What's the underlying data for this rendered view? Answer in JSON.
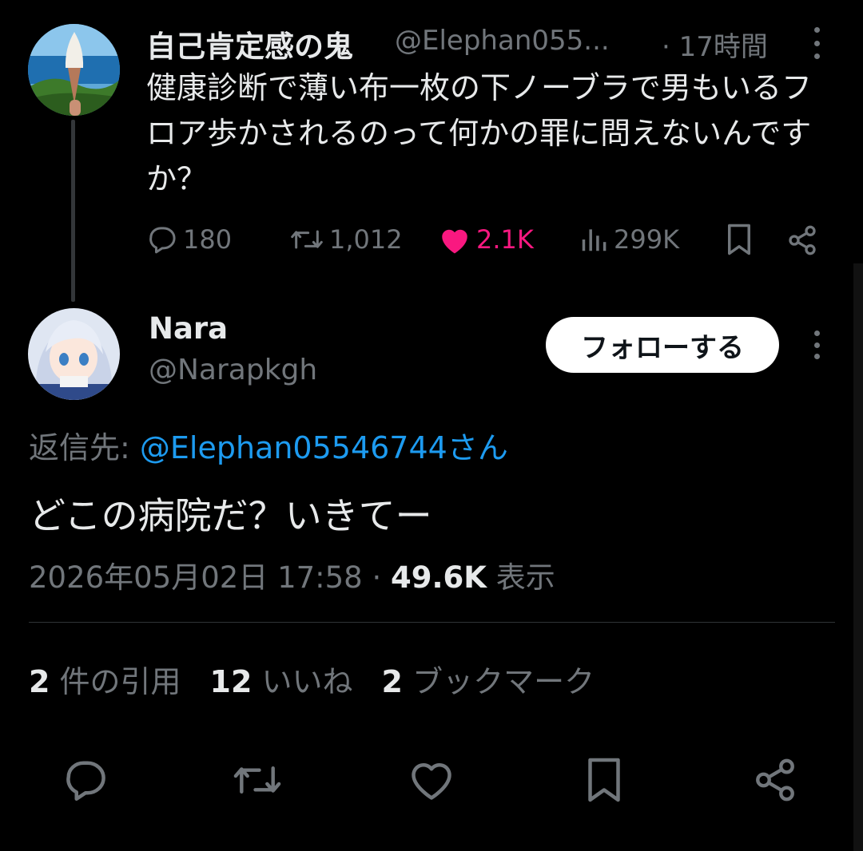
{
  "original_tweet": {
    "display_name": "自己肯定感の鬼",
    "handle": "@Elephan055...",
    "time": "· 17時間",
    "text": "健康診断で薄い布一枚の下ノーブラで男もいるフロア歩かされるのって何かの罪に問えないんですか？",
    "actions": {
      "replies": "180",
      "retweets": "1,012",
      "likes": "2.1K",
      "views": "299K"
    },
    "like_color": "#f91880"
  },
  "reply_tweet": {
    "display_name": "Nara",
    "handle": "@Narapkgh",
    "follow_label": "フォローする",
    "reply_to_prefix": "返信先: ",
    "reply_to_mention": "@Elephan05546744さん",
    "text": "どこの病院だ？いきてー",
    "timestamp": "2026年05月02日 17:58 · ",
    "views_count": "49.6K",
    "views_label": " 表示",
    "stats": {
      "quotes_count": "2",
      "quotes_label": " 件の引用",
      "likes_count": "12",
      "likes_label": " いいね",
      "bookmarks_count": "2",
      "bookmarks_label": " ブックマーク"
    }
  },
  "icons": {
    "reply": "reply-icon",
    "retweet": "retweet-icon",
    "like": "heart-icon",
    "views": "views-icon",
    "bookmark": "bookmark-icon",
    "share": "share-icon",
    "more": "more-icon"
  },
  "colors": {
    "background": "#000000",
    "text": "#e7e9ea",
    "secondary": "#71767b",
    "link": "#1d9bf0",
    "like": "#f91880"
  }
}
